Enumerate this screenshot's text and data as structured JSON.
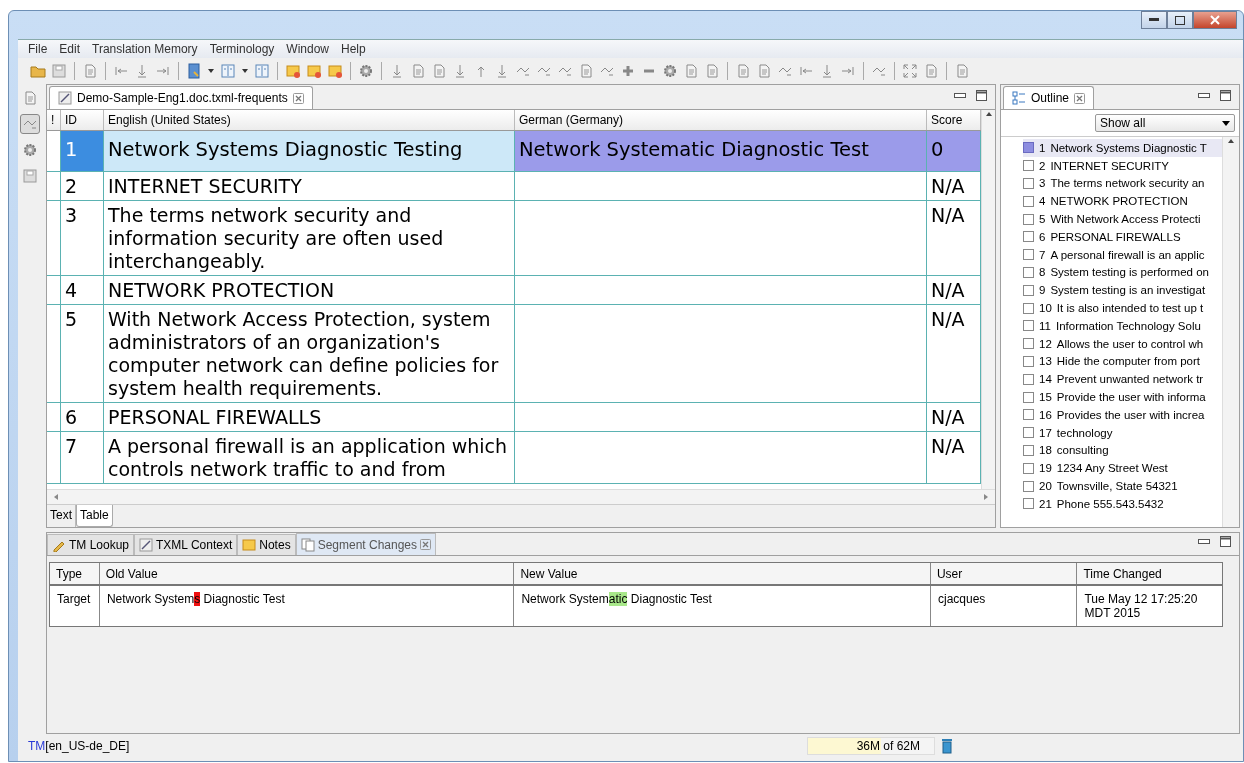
{
  "menu": [
    "File",
    "Edit",
    "Translation Memory",
    "Terminology",
    "Window",
    "Help"
  ],
  "editor": {
    "tab": {
      "title": "Demo-Sample-Eng1.doc.txml-frequents"
    },
    "columns": [
      "!",
      "ID",
      "English (United States)",
      "German (Germany)",
      "Score"
    ],
    "rows": [
      {
        "id": "1",
        "source": "Network Systems Diagnostic Testing",
        "target": "Network Systematic Diagnostic Test",
        "score": "0",
        "selected": true
      },
      {
        "id": "2",
        "source": "INTERNET SECURITY",
        "target": "",
        "score": "N/A",
        "selected": false
      },
      {
        "id": "3",
        "source": "The terms network security and information security are often used interchangeably.",
        "target": "",
        "score": "N/A",
        "selected": false
      },
      {
        "id": "4",
        "source": "NETWORK PROTECTION",
        "target": "",
        "score": "N/A",
        "selected": false
      },
      {
        "id": "5",
        "source": "With Network Access Protection, system administrators of an organization's computer network can define policies for system health requirements.",
        "target": "",
        "score": "N/A",
        "selected": false
      },
      {
        "id": "6",
        "source": "PERSONAL FIREWALLS",
        "target": "",
        "score": "N/A",
        "selected": false
      },
      {
        "id": "7",
        "source": "A personal firewall is an application which controls network traffic to and from",
        "target": "",
        "score": "N/A",
        "selected": false
      }
    ],
    "view_tabs": [
      {
        "label": "Text",
        "selected": false
      },
      {
        "label": "Table",
        "selected": true
      }
    ]
  },
  "outline": {
    "title": "Outline",
    "filter": "Show all",
    "items": [
      {
        "number": "1",
        "text": "Network Systems Diagnostic T",
        "selected": true
      },
      {
        "number": "2",
        "text": "INTERNET SECURITY",
        "selected": false
      },
      {
        "number": "3",
        "text": "The terms network security an",
        "selected": false
      },
      {
        "number": "4",
        "text": "NETWORK PROTECTION",
        "selected": false
      },
      {
        "number": "5",
        "text": "With Network Access Protecti",
        "selected": false
      },
      {
        "number": "6",
        "text": "PERSONAL FIREWALLS",
        "selected": false
      },
      {
        "number": "7",
        "text": "A personal firewall is an applic",
        "selected": false
      },
      {
        "number": "8",
        "text": "System testing is performed on",
        "selected": false
      },
      {
        "number": "9",
        "text": "System testing is an investigat",
        "selected": false
      },
      {
        "number": "10",
        "text": "It is also intended to test up t",
        "selected": false
      },
      {
        "number": "11",
        "text": "Information Technology Solu",
        "selected": false
      },
      {
        "number": "12",
        "text": "Allows the user to control wh",
        "selected": false
      },
      {
        "number": "13",
        "text": "Hide the computer from port",
        "selected": false
      },
      {
        "number": "14",
        "text": "Prevent unwanted network tr",
        "selected": false
      },
      {
        "number": "15",
        "text": "Provide the user with informa",
        "selected": false
      },
      {
        "number": "16",
        "text": "Provides the user with increa",
        "selected": false
      },
      {
        "number": "17",
        "text": "technology",
        "selected": false
      },
      {
        "number": "18",
        "text": "consulting",
        "selected": false
      },
      {
        "number": "19",
        "text": "1234 Any Street West",
        "selected": false
      },
      {
        "number": "20",
        "text": "Townsville, State 54321",
        "selected": false
      },
      {
        "number": "21",
        "text": "Phone 555.543.5432",
        "selected": false
      }
    ]
  },
  "bottom_panel": {
    "tabs": [
      {
        "label": "TM Lookup",
        "kind": "key",
        "selected": false
      },
      {
        "label": "TXML Context",
        "kind": "pen",
        "selected": false
      },
      {
        "label": "Notes",
        "kind": "note",
        "selected": false
      },
      {
        "label": "Segment Changes",
        "kind": "pages",
        "selected": true
      }
    ],
    "columns": [
      "Type",
      "Old Value",
      "New Value",
      "User",
      "Time Changed"
    ],
    "rows": [
      {
        "type": "Target",
        "old_value": [
          {
            "text": "Network System",
            "kind": "plain"
          },
          {
            "text": "s",
            "kind": "deleted"
          },
          {
            "text": " Diagnostic Test",
            "kind": "plain"
          }
        ],
        "new_value": [
          {
            "text": "Network System",
            "kind": "plain"
          },
          {
            "text": "atic",
            "kind": "inserted"
          },
          {
            "text": " Diagnostic Test",
            "kind": "plain"
          }
        ],
        "user": "cjacques",
        "time_changed": "Tue May 12 17:25:20 MDT 2015"
      }
    ]
  },
  "status_bar": {
    "tm": "TM",
    "locale": "[en_US-de_DE]",
    "memory": "36M of 62M",
    "level": 0.58
  }
}
